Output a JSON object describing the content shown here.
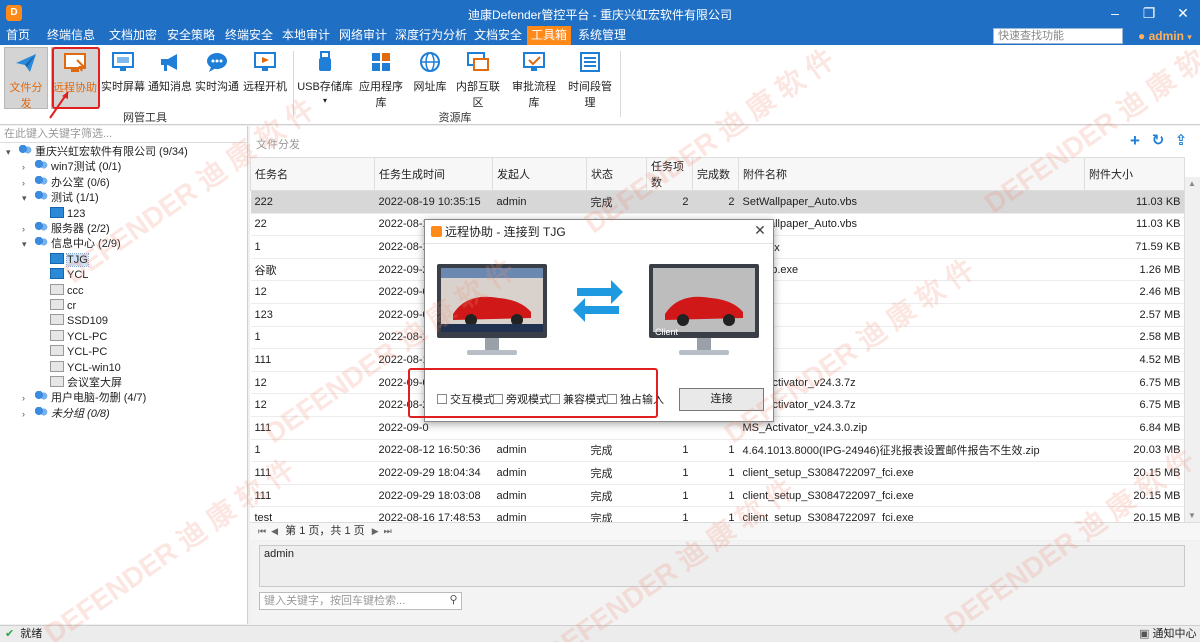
{
  "window": {
    "title": "迪康Defender管控平台 - 重庆兴虹宏软件有限公司",
    "logo": "logo-icon"
  },
  "menu": {
    "items": [
      "首页",
      "终端信息",
      "文档加密",
      "安全策略",
      "终端安全",
      "本地审计",
      "网络审计",
      "深度行为分析",
      "文档安全",
      "工具箱",
      "系统管理"
    ],
    "active": "工具箱",
    "quick_search_placeholder": "快速查找功能",
    "user": "admin"
  },
  "ribbon": {
    "buttons": [
      "文件分发",
      "远程协助",
      "实时屏幕",
      "通知消息",
      "实时沟通",
      "远程开机",
      "USB存储库",
      "应用程序库",
      "网址库",
      "内部互联区",
      "审批流程库",
      "时间段管理"
    ],
    "group_net": "网管工具",
    "group_res": "资源库",
    "selected": "文件分发"
  },
  "left": {
    "filter_placeholder": "在此键入关键字筛选...",
    "tree": [
      {
        "label": "重庆兴虹宏软件有限公司 (9/34)",
        "level": 0,
        "arrow": "▾",
        "icon": "group-icon"
      },
      {
        "label": "win7测试 (0/1)",
        "level": 1,
        "arrow": "›",
        "icon": "group-icon"
      },
      {
        "label": "办公室 (0/6)",
        "level": 1,
        "arrow": "›",
        "icon": "group-icon"
      },
      {
        "label": "测试 (1/1)",
        "level": 1,
        "arrow": "▾",
        "icon": "group-icon"
      },
      {
        "label": "123",
        "level": 2,
        "arrow": "",
        "icon": "pc-online-icon"
      },
      {
        "label": "服务器 (2/2)",
        "level": 1,
        "arrow": "›",
        "icon": "group-icon"
      },
      {
        "label": "信息中心 (2/9)",
        "level": 1,
        "arrow": "▾",
        "icon": "group-icon"
      },
      {
        "label": "TJG",
        "level": 2,
        "arrow": "",
        "icon": "pc-online-icon"
      },
      {
        "label": "YCL",
        "level": 2,
        "arrow": "",
        "icon": "pc-online-icon"
      },
      {
        "label": "ccc",
        "level": 2,
        "arrow": "",
        "icon": "pc-offline-icon"
      },
      {
        "label": "cr",
        "level": 2,
        "arrow": "",
        "icon": "pc-offline-icon"
      },
      {
        "label": "SSD109",
        "level": 2,
        "arrow": "",
        "icon": "pc-offline-icon"
      },
      {
        "label": "YCL-PC",
        "level": 2,
        "arrow": "",
        "icon": "pc-offline-icon"
      },
      {
        "label": "YCL-PC",
        "level": 2,
        "arrow": "",
        "icon": "pc-offline-icon"
      },
      {
        "label": "YCL-win10",
        "level": 2,
        "arrow": "",
        "icon": "pc-offline-icon"
      },
      {
        "label": "会议室大屏",
        "level": 2,
        "arrow": "",
        "icon": "pc-offline-icon"
      },
      {
        "label": "用户电脑-勿删 (4/7)",
        "level": 1,
        "arrow": "›",
        "icon": "group-icon"
      },
      {
        "label": "未分组 (0/8)",
        "level": 1,
        "arrow": "›",
        "icon": "group-icon"
      }
    ]
  },
  "main": {
    "panel_title": "文件分发",
    "columns": [
      "任务名",
      "任务生成时间",
      "发起人",
      "状态",
      "任务项数",
      "完成数",
      "附件名称",
      "附件大小"
    ],
    "rows": [
      [
        "222",
        "2022-08-19 10:35:15",
        "admin",
        "完成",
        "2",
        "2",
        "SetWallpaper_Auto.vbs",
        "11.03 KB"
      ],
      [
        "22",
        "2022-08-19 10:32:52",
        "admin",
        "完成",
        "2",
        "2",
        "SetWallpaper_Auto.vbs",
        "11.03 KB"
      ],
      [
        "1",
        "2022-08-1",
        "",
        "",
        "",
        "",
        "入.docx",
        "71.59 KB"
      ],
      [
        "谷歌",
        "2022-09-2",
        "",
        "",
        "",
        "",
        "eSetup.exe",
        "1.26 MB"
      ],
      [
        "12",
        "2022-09-0",
        "",
        "",
        "",
        "",
        "g",
        "2.46 MB"
      ],
      [
        "123",
        "2022-09-0",
        "",
        "",
        "",
        "",
        "z",
        "2.57 MB"
      ],
      [
        "1",
        "2022-08-1",
        "",
        "",
        "",
        "",
        "2).7z",
        "2.58 MB"
      ],
      [
        "111",
        "2022-08-1",
        "",
        "",
        "",
        "",
        "cx",
        "4.52 MB"
      ],
      [
        "12",
        "2022-09-0",
        "",
        "",
        "",
        "",
        "MS_Activator_v24.3.7z",
        "6.75 MB"
      ],
      [
        "12",
        "2022-08-2",
        "",
        "",
        "",
        "",
        "MS_Activator_v24.3.7z",
        "6.75 MB"
      ],
      [
        "111",
        "2022-09-0",
        "",
        "",
        "",
        "",
        "MS_Activator_v24.3.0.zip",
        "6.84 MB"
      ],
      [
        "1",
        "2022-08-12 16:50:36",
        "admin",
        "完成",
        "1",
        "1",
        "4.64.1013.8000(IPG-24946)征兆报表设置邮件报告不生效.zip",
        "20.03 MB"
      ],
      [
        "111",
        "2022-09-29 18:04:34",
        "admin",
        "完成",
        "1",
        "1",
        "client_setup_S3084722097_fci.exe",
        "20.15 MB"
      ],
      [
        "111",
        "2022-09-29 18:03:08",
        "admin",
        "完成",
        "1",
        "1",
        "client_setup_S3084722097_fci.exe",
        "20.15 MB"
      ],
      [
        "test",
        "2022-08-16 17:48:53",
        "admin",
        "完成",
        "1",
        "1",
        "client_setup_S3084722097_fci.exe",
        "20.15 MB"
      ]
    ],
    "pager": "第 1 页，共 1 页",
    "detail_text": "admin",
    "keyword_placeholder": "键入关键字，按回车键检索..."
  },
  "status": {
    "text": "就绪",
    "notify": "通知中心"
  },
  "dialog": {
    "title": "远程协助 - 连接到 TJG",
    "left_label": "",
    "right_label": "Client",
    "options": [
      "交互模式",
      "旁观模式",
      "兼容模式",
      "独占输入"
    ],
    "connect": "连接"
  },
  "watermark": "DEFENDER 迪 康 软 件",
  "colors": {
    "accent": "#1f6fc4",
    "active_tab": "#ff8a1a",
    "annotation": "#e02020"
  }
}
